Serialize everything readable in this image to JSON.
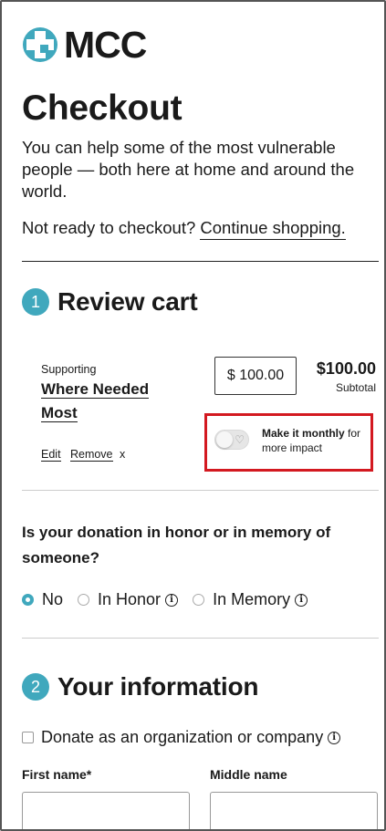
{
  "brand": {
    "name": "MCC",
    "accent": "#40a8bd"
  },
  "page_title": "Checkout",
  "intro": "You can help some of the most vulnerable people — both here at home and around the world.",
  "not_ready": {
    "text": "Not ready to checkout?",
    "link": "Continue shopping."
  },
  "review": {
    "step": "1",
    "title": "Review cart",
    "supporting_label": "Supporting",
    "fund_name": "Where Needed Most",
    "edit": "Edit",
    "remove": "Remove",
    "remove_x": "x",
    "amount_value": "$ 100.00",
    "total": "$100.00",
    "subtotal_label": "Subtotal",
    "monthly_bold": "Make it monthly",
    "monthly_rest": " for more impact",
    "monthly_enabled": false
  },
  "honor": {
    "question": "Is your donation in honor or in memory of someone?",
    "options": [
      "No",
      "In Honor",
      "In Memory"
    ],
    "selected": "No"
  },
  "info_section": {
    "step": "2",
    "title": "Your information",
    "org_checkbox": "Donate as an organization or company",
    "first_name_label": "First name*",
    "middle_name_label": "Middle name"
  }
}
